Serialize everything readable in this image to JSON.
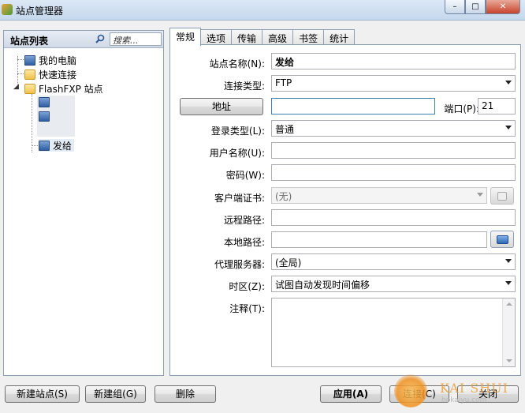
{
  "window": {
    "title": "站点管理器",
    "controls": {
      "minimize": "–",
      "maximize": "□",
      "close": "✕"
    }
  },
  "sidebar": {
    "title": "站点列表",
    "search_placeholder": "搜索...",
    "tree": [
      {
        "label": "我的电脑",
        "icon": "computer-icon"
      },
      {
        "label": "快速连接",
        "icon": "folder-icon"
      },
      {
        "label": "FlashFXP 站点",
        "icon": "folder-icon",
        "expanded": true
      },
      {
        "label": "发给",
        "icon": "site-icon",
        "selected": true
      }
    ]
  },
  "tabs": [
    {
      "label": "常规",
      "active": true
    },
    {
      "label": "选项"
    },
    {
      "label": "传输"
    },
    {
      "label": "高级"
    },
    {
      "label": "书签"
    },
    {
      "label": "统计"
    }
  ],
  "form": {
    "site_name_label": "站点名称(N):",
    "site_name_value": "发给",
    "connection_type_label": "连接类型:",
    "connection_type_value": "FTP",
    "address_button": "地址",
    "address_value": "",
    "port_label": "端口(P):",
    "port_value": "21",
    "login_type_label": "登录类型(L):",
    "login_type_value": "普通",
    "username_label": "用户名称(U):",
    "username_value": "",
    "password_label": "密码(W):",
    "password_value": "",
    "client_cert_label": "客户端证书:",
    "client_cert_value": "(无)",
    "remote_path_label": "远程路径:",
    "remote_path_value": "",
    "local_path_label": "本地路径:",
    "local_path_value": "",
    "proxy_label": "代理服务器:",
    "proxy_value": "(全局)",
    "timezone_label": "时区(Z):",
    "timezone_value": "试图自动发现时间偏移",
    "notes_label": "注释(T):",
    "notes_value": ""
  },
  "buttons": {
    "new_site": "新建站点(S)",
    "new_group": "新建组(G)",
    "delete": "删除",
    "apply": "应用(A)",
    "connect": "连接(C)",
    "close": "关闭"
  },
  "watermark": {
    "text": "KAI SHUI",
    "sub": "hokaiyu.com"
  }
}
